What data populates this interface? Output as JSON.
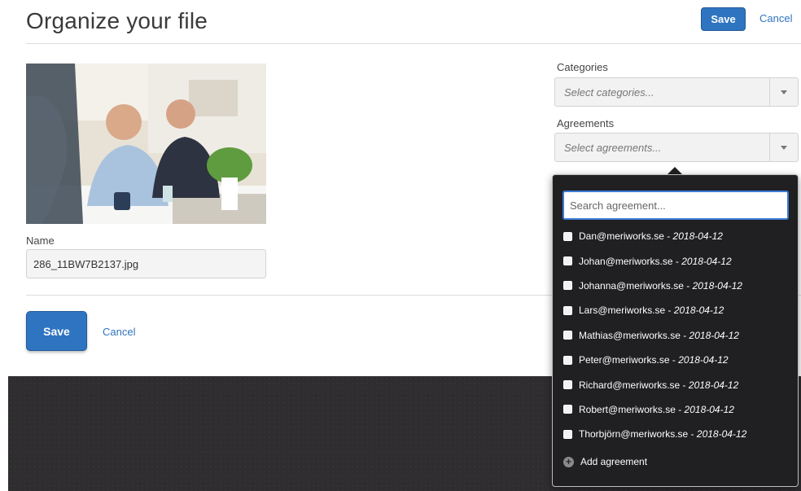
{
  "header": {
    "title": "Organize your file",
    "save_label": "Save",
    "cancel_label": "Cancel"
  },
  "form": {
    "name_label": "Name",
    "name_value": "286_11BW7B2137.jpg",
    "save_label": "Save",
    "cancel_label": "Cancel"
  },
  "categories": {
    "label": "Categories",
    "placeholder": "Select categories..."
  },
  "agreements": {
    "label": "Agreements",
    "placeholder": "Select agreements...",
    "search_placeholder": "Search agreement...",
    "items": [
      {
        "email": "Dan@meriworks.se",
        "sep": " - ",
        "date": "2018-04-12"
      },
      {
        "email": "Johan@meriworks.se",
        "sep": " - ",
        "date": "2018-04-12"
      },
      {
        "email": "Johanna@meriworks.se",
        "sep": " - ",
        "date": "2018-04-12"
      },
      {
        "email": "Lars@meriworks.se",
        "sep": " - ",
        "date": "2018-04-12"
      },
      {
        "email": "Mathias@meriworks.se",
        "sep": " - ",
        "date": "2018-04-12"
      },
      {
        "email": "Peter@meriworks.se",
        "sep": " - ",
        "date": "2018-04-12"
      },
      {
        "email": "Richard@meriworks.se",
        "sep": " - ",
        "date": "2018-04-12"
      },
      {
        "email": "Robert@meriworks.se",
        "sep": " - ",
        "date": "2018-04-12"
      },
      {
        "email": "Thorbjörn@meriworks.se",
        "sep": " - ",
        "date": "2018-04-12"
      }
    ],
    "add_label": "Add agreement"
  },
  "colors": {
    "accent": "#2f74c0",
    "dropdown_bg": "#201f21",
    "footer_bg": "#2f2d2f"
  }
}
